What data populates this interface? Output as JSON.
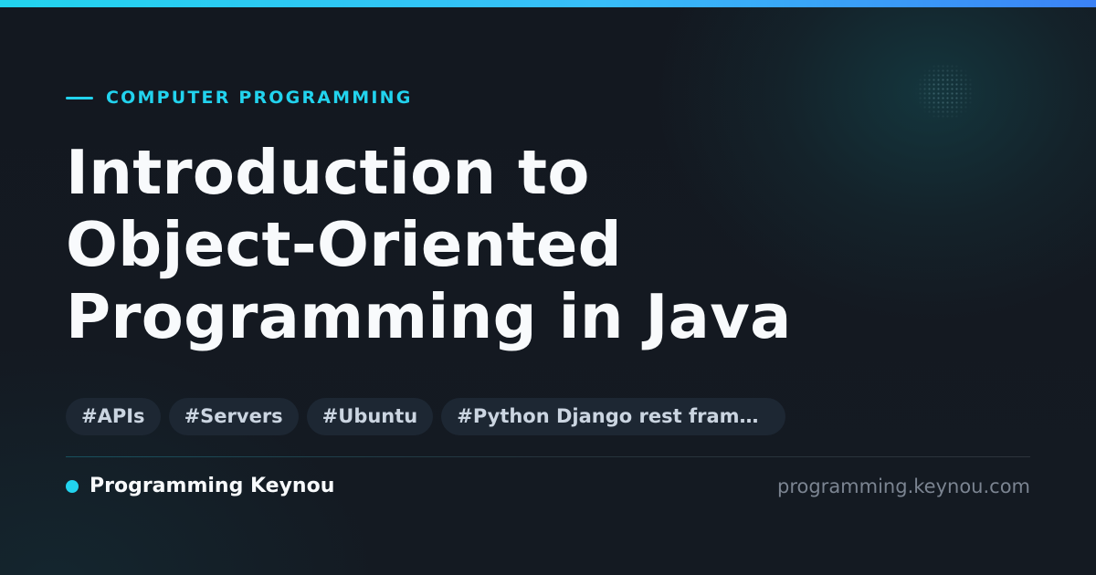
{
  "category": "COMPUTER PROGRAMMING",
  "title": {
    "line1": "Introduction to",
    "line2": "Object-Oriented",
    "line3": "Programming in Java"
  },
  "tags": [
    "#APIs",
    "#Servers",
    "#Ubuntu",
    "#Python Django rest framework"
  ],
  "brand": {
    "name": "Programming Keynou",
    "domain": "programming.keynou.com"
  },
  "colors": {
    "accent": "#22d3ee",
    "accent_secondary": "#3b82f6",
    "background": "#131820",
    "tag_background": "#1d2733",
    "title_text": "#f8fafc",
    "muted_text": "#7b8491"
  }
}
